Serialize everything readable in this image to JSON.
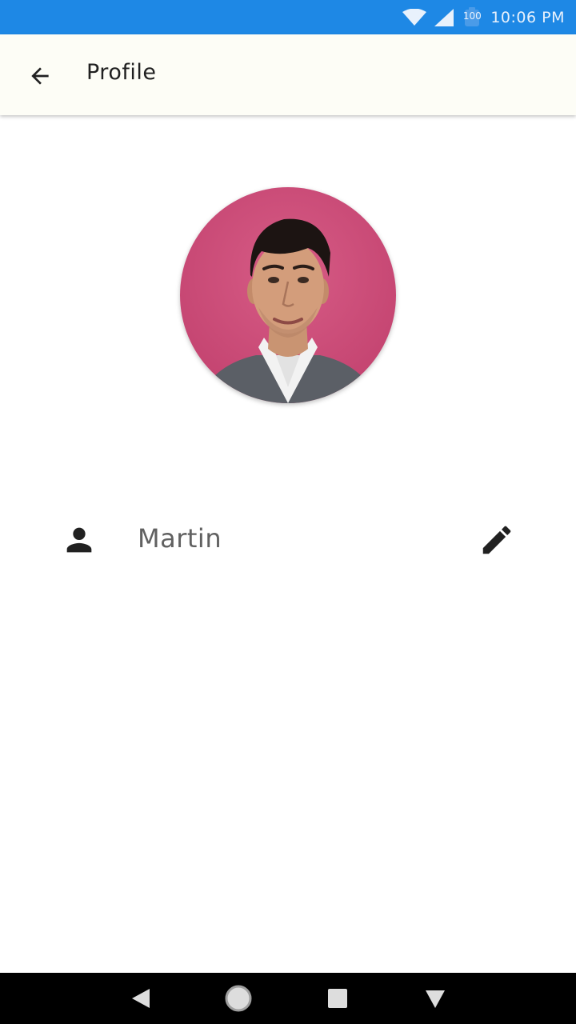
{
  "status_bar": {
    "time": "10:06 PM",
    "battery_level": "100",
    "icons": [
      "wifi-icon",
      "signal-icon",
      "battery-icon"
    ],
    "background": "#1e88e5"
  },
  "app_bar": {
    "title": "Profile",
    "back_icon": "arrow-back-icon",
    "background": "#fdfdf6"
  },
  "profile": {
    "avatar": "profile-photo",
    "name": "Martin",
    "name_icon": "person-icon",
    "edit_icon": "pencil-icon"
  },
  "navigation_bar": {
    "buttons": [
      "back-triangle-icon",
      "home-circle-icon",
      "recents-square-icon",
      "dropdown-triangle-icon"
    ]
  }
}
